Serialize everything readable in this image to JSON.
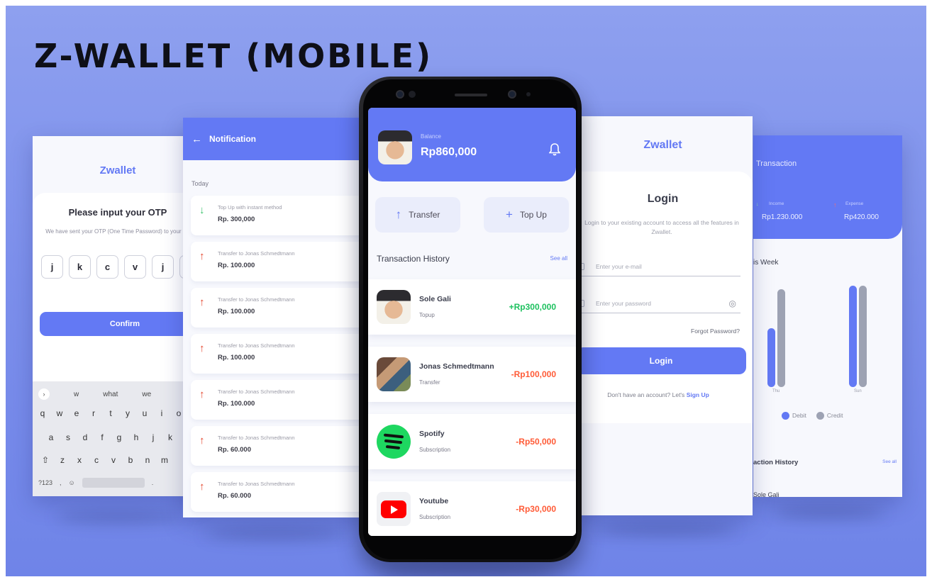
{
  "page_title": "Z-WALLET (MOBILE)",
  "colors": {
    "primary": "#6379f4",
    "income": "#1ec15f",
    "expense": "#ff5b37",
    "background": "#7d90ec"
  },
  "otp_screen": {
    "brand": "Zwallet",
    "heading": "Please input your OTP",
    "description": "We have sent your OTP (One Time Password) to your Email",
    "otp_chars": [
      "j",
      "k",
      "c",
      "v",
      "j"
    ],
    "confirm_label": "Confirm",
    "keyboard": {
      "suggestions": [
        "w",
        "what",
        "we"
      ],
      "row1": [
        "q",
        "w",
        "e",
        "r",
        "t",
        "y",
        "u",
        "i",
        "o"
      ],
      "row2": [
        "a",
        "s",
        "d",
        "f",
        "g",
        "h",
        "j",
        "k"
      ],
      "row3": [
        "z",
        "x",
        "c",
        "v",
        "b",
        "n",
        "m"
      ],
      "numbers_key": "?123",
      "comma_key": ",",
      "period_key": "."
    }
  },
  "notification_screen": {
    "title": "Notification",
    "section_today": "Today",
    "items": [
      {
        "direction": "in",
        "title": "Top Up with instant method",
        "amount": "Rp. 300,000"
      },
      {
        "direction": "out",
        "title": "Transfer to Jonas Schmedtmann",
        "amount": "Rp. 100.000"
      },
      {
        "direction": "out",
        "title": "Transfer to Jonas Schmedtmann",
        "amount": "Rp. 100.000"
      },
      {
        "direction": "out",
        "title": "Transfer to Jonas Schmedtmann",
        "amount": "Rp. 100.000"
      },
      {
        "direction": "out",
        "title": "Transfer to Jonas Schmedtmann",
        "amount": "Rp. 100.000"
      },
      {
        "direction": "out",
        "title": "Transfer to Jonas Schmedtmann",
        "amount": "Rp. 60.000"
      },
      {
        "direction": "out",
        "title": "Transfer to Jonas Schmedtmann",
        "amount": "Rp. 60.000"
      }
    ]
  },
  "home_screen": {
    "balance_label": "Balance",
    "balance_value": "Rp860,000",
    "transfer_label": "Transfer",
    "topup_label": "Top Up",
    "history_title": "Transaction History",
    "see_all": "See all",
    "transactions": [
      {
        "name": "Sole Gali",
        "type": "Topup",
        "amount": "+Rp300,000",
        "sign": "pos",
        "icon": "user-avatar"
      },
      {
        "name": "Jonas Schmedtmann",
        "type": "Transfer",
        "amount": "-Rp100,000",
        "sign": "neg",
        "icon": "user-avatar"
      },
      {
        "name": "Spotify",
        "type": "Subscription",
        "amount": "-Rp50,000",
        "sign": "neg",
        "icon": "spotify-icon"
      },
      {
        "name": "Youtube",
        "type": "Subscription",
        "amount": "-Rp30,000",
        "sign": "neg",
        "icon": "youtube-icon"
      }
    ]
  },
  "login_screen": {
    "brand": "Zwallet",
    "heading": "Login",
    "description": "Login to your existing account to access all the features in Zwallet.",
    "email_placeholder": "Enter your e-mail",
    "password_placeholder": "Enter your password",
    "forgot_password": "Forgot Password?",
    "login_label": "Login",
    "signup_prompt": "Don't have an account? Let's",
    "signup_link": "Sign Up"
  },
  "dashboard_screen": {
    "title": "Transaction",
    "income_label": "Income",
    "income_value": "Rp1.230.000",
    "expense_label": "Expense",
    "expense_value": "Rp420.000",
    "week_label": "is Week",
    "day_labels": [
      "Thu",
      "Sun"
    ],
    "legend_debit": "Debit",
    "legend_credit": "Credit",
    "bars": [
      {
        "debit": 0.55,
        "credit": 0.92
      },
      {
        "debit": 0.95,
        "credit": 0.95
      }
    ],
    "history_title": "action History",
    "see_all": "See all",
    "first_row_name": "Sole Gali"
  }
}
